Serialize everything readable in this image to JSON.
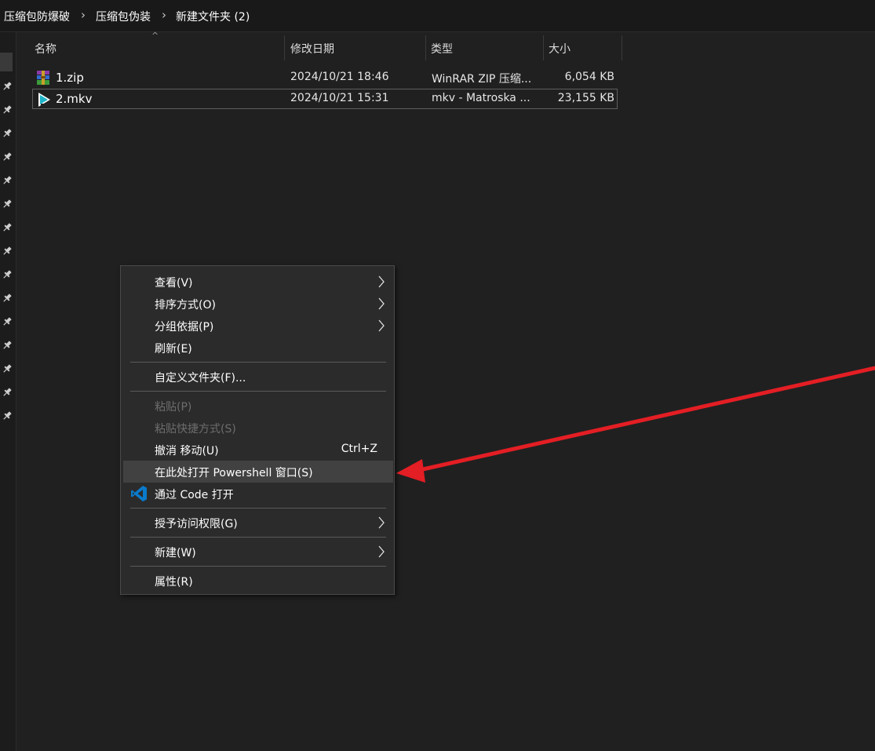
{
  "breadcrumb": {
    "items": [
      "压缩包防爆破",
      "压缩包伪装",
      "新建文件夹 (2)"
    ]
  },
  "columns": {
    "name": "名称",
    "date": "修改日期",
    "type": "类型",
    "size": "大小"
  },
  "files": [
    {
      "name": "1.zip",
      "date": "2024/10/21 18:46",
      "type": "WinRAR ZIP 压缩...",
      "size": "6,054 KB",
      "icon": "winrar-archive-icon"
    },
    {
      "name": "2.mkv",
      "date": "2024/10/21 15:31",
      "type": "mkv - Matroska ...",
      "size": "23,155 KB",
      "icon": "video-file-icon"
    }
  ],
  "context_menu": {
    "items": [
      {
        "label": "查看(V)",
        "submenu": true
      },
      {
        "label": "排序方式(O)",
        "submenu": true
      },
      {
        "label": "分组依据(P)",
        "submenu": true
      },
      {
        "label": "刷新(E)"
      },
      {
        "label": "自定义文件夹(F)..."
      },
      {
        "label": "粘贴(P)",
        "disabled": true
      },
      {
        "label": "粘贴快捷方式(S)",
        "disabled": true
      },
      {
        "label": "撤消 移动(U)",
        "shortcut": "Ctrl+Z"
      },
      {
        "label": "在此处打开 Powershell 窗口(S)",
        "highlighted": true
      },
      {
        "label": "通过 Code 打开",
        "icon": "vscode-icon"
      },
      {
        "label": "授予访问权限(G)",
        "submenu": true
      },
      {
        "label": "新建(W)",
        "submenu": true
      },
      {
        "label": "属性(R)"
      }
    ]
  },
  "colors": {
    "background": "#202020",
    "menu_background": "#2b2b2b",
    "annotation_arrow": "#e31e24",
    "vscode_blue": "#0a7acc"
  }
}
